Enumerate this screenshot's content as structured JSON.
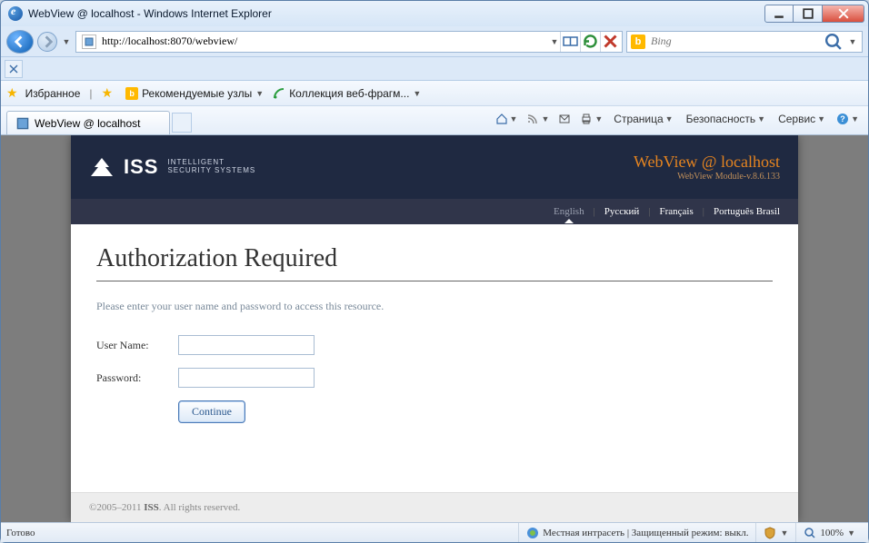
{
  "window": {
    "title": "WebView @ localhost - Windows Internet Explorer"
  },
  "nav": {
    "url": "http://localhost:8070/webview/",
    "search_placeholder": "Bing"
  },
  "favbar": {
    "favorites": "Избранное",
    "recommended": "Рекомендуемые узлы",
    "webfrag": "Коллекция веб-фрагм..."
  },
  "tab": {
    "title": "WebView @ localhost"
  },
  "cmdbar": {
    "page": "Страница",
    "safety": "Безопасность",
    "tools": "Сервис"
  },
  "webview": {
    "brand": "ISS",
    "brand_sub1": "INTELLIGENT",
    "brand_sub2": "SECURITY SYSTEMS",
    "header_title": "WebView @ localhost",
    "header_sub": "WebView Module-v.8.6.133",
    "langs": {
      "en": "English",
      "ru": "Русский",
      "fr": "Français",
      "pt": "Português Brasil"
    },
    "h1": "Authorization Required",
    "instruction": "Please enter your user name and password to access this resource.",
    "username_label": "User Name:",
    "password_label": "Password:",
    "continue": "Continue",
    "footer_years": "©2005–2011 ",
    "footer_brand": "ISS",
    "footer_rest": ". All rights reserved."
  },
  "status": {
    "ready": "Готово",
    "zone": "Местная интрасеть | Защищенный режим: выкл.",
    "zoom": "100%"
  }
}
